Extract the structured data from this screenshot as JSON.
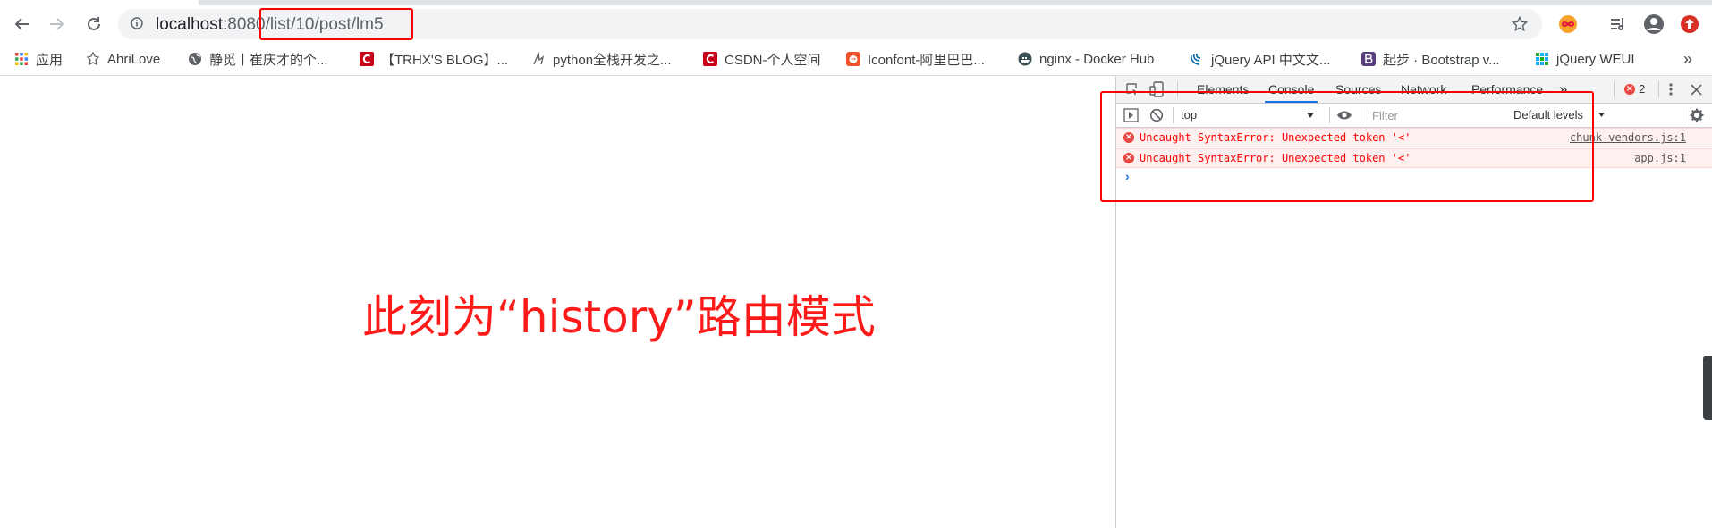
{
  "toolbar": {
    "url_host": "localhost:",
    "url_port": "8080",
    "url_path": "/list/10/post/lm5"
  },
  "bookmarks": [
    {
      "label": "应用",
      "icon": "apps-grid-icon"
    },
    {
      "label": "AhriLove",
      "icon": "site-icon"
    },
    {
      "label": "静觅丨崔庆才的个...",
      "icon": "globe-icon"
    },
    {
      "label": "【TRHX'S BLOG】...",
      "icon": "csdn-icon"
    },
    {
      "label": "python全栈开发之...",
      "icon": "site-icon"
    },
    {
      "label": "CSDN-个人空间",
      "icon": "csdn-icon"
    },
    {
      "label": "Iconfont-阿里巴巴...",
      "icon": "iconfont-icon"
    },
    {
      "label": "nginx - Docker Hub",
      "icon": "docker-icon"
    },
    {
      "label": "jQuery API 中文文...",
      "icon": "jquery-icon"
    },
    {
      "label": "起步 · Bootstrap v...",
      "icon": "bootstrap-icon"
    },
    {
      "label": "jQuery WEUI",
      "icon": "weui-icon"
    }
  ],
  "bookmarks_more": "»",
  "annotation": "此刻为“history”路由模式",
  "devtools": {
    "tabs": [
      "Elements",
      "Console",
      "Sources",
      "Network",
      "Performance"
    ],
    "more_tabs": "»",
    "error_count": "2",
    "context": "top",
    "filter_placeholder": "Filter",
    "levels": "Default levels",
    "logs": [
      {
        "message": "Uncaught SyntaxError: Unexpected token '<'",
        "source": "chunk-vendors.js:1"
      },
      {
        "message": "Uncaught SyntaxError: Unexpected token '<'",
        "source": "app.js:1"
      }
    ],
    "prompt": "›"
  },
  "colors": {
    "annotation_red": "#ff1a1a",
    "error_red": "#ff0000",
    "accent_blue": "#1a73e8"
  }
}
